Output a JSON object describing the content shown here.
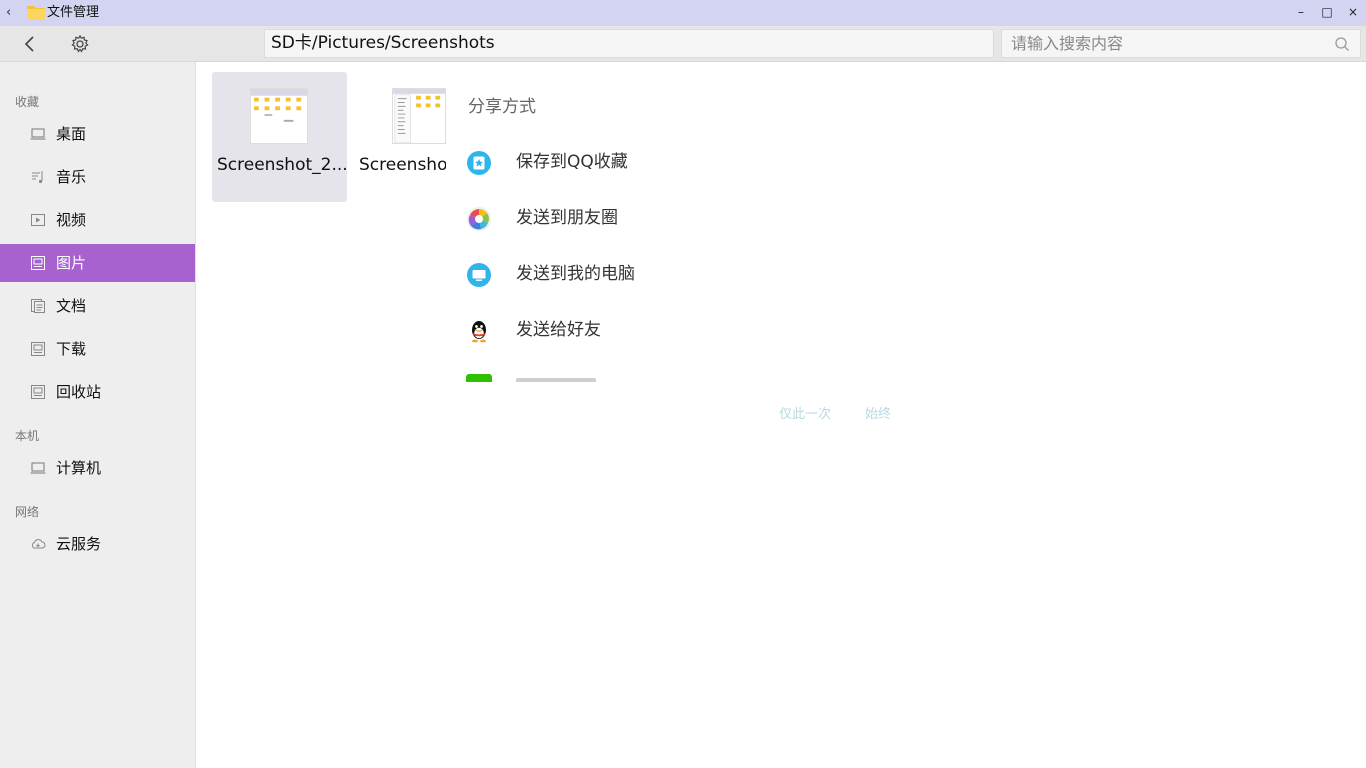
{
  "window": {
    "title": "文件管理",
    "controls": {
      "minimize": "–",
      "maximize": "□",
      "close": "×"
    }
  },
  "toolbar": {
    "path": "SD卡/Pictures/Screenshots",
    "search_placeholder": "请输入搜索内容"
  },
  "sidebar": {
    "sections": [
      {
        "heading": "收藏",
        "items": [
          {
            "label": "桌面",
            "icon": "monitor-icon"
          },
          {
            "label": "音乐",
            "icon": "music-icon"
          },
          {
            "label": "视频",
            "icon": "video-icon"
          },
          {
            "label": "图片",
            "icon": "picture-icon",
            "active": true
          },
          {
            "label": "文档",
            "icon": "document-icon"
          },
          {
            "label": "下载",
            "icon": "download-icon"
          },
          {
            "label": "回收站",
            "icon": "trash-icon"
          }
        ]
      },
      {
        "heading": "本机",
        "items": [
          {
            "label": "计算机",
            "icon": "computer-icon"
          }
        ]
      },
      {
        "heading": "网络",
        "items": [
          {
            "label": "云服务",
            "icon": "cloud-icon"
          }
        ]
      }
    ]
  },
  "files": [
    {
      "name": "Screenshot_2...",
      "selected": true
    },
    {
      "name": "Screensho",
      "selected": false
    }
  ],
  "share": {
    "title": "分享方式",
    "items": [
      {
        "label": "保存到QQ收藏",
        "icon": "qq-favorites-icon"
      },
      {
        "label": "发送到朋友圈",
        "icon": "moments-icon"
      },
      {
        "label": "发送到我的电脑",
        "icon": "my-computer-icon"
      },
      {
        "label": "发送给好友",
        "icon": "qq-friend-icon"
      }
    ],
    "just_once": "仅此一次",
    "always": "始终"
  },
  "colors": {
    "accent": "#a862d0",
    "titlebar": "#d2d4f2",
    "share_button": "#b5dbe0"
  }
}
